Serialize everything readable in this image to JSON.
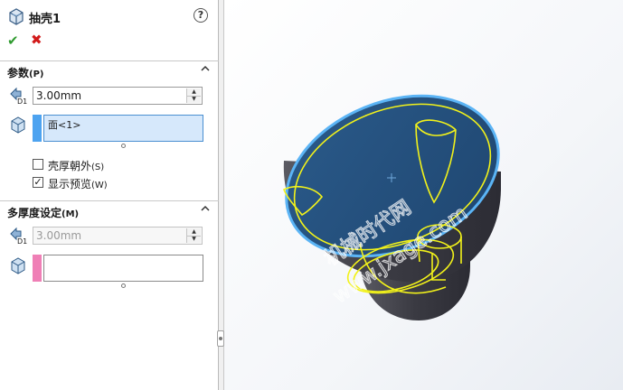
{
  "panel": {
    "title": "抽壳1",
    "help_icon": "help-icon",
    "ok_icon": "check-icon",
    "cancel_icon": "close-icon"
  },
  "parameters": {
    "title": "参数",
    "shortcut": "(P)",
    "thickness": "3.00mm",
    "faces_item": "面<1>",
    "shell_outward_label": "壳厚朝外",
    "shell_outward_shortcut": "(S)",
    "shell_outward_checked": false,
    "show_preview_label": "显示预览",
    "show_preview_shortcut": "(W)",
    "show_preview_checked": true
  },
  "multi_thickness": {
    "title": "多厚度设定",
    "shortcut": "(M)",
    "thickness": "3.00mm"
  },
  "watermark": {
    "line1": "机械时代网",
    "line2": "www.jxage.com"
  },
  "colors": {
    "selection_blue": "#4da3f0",
    "selection_pink": "#ef7fb6",
    "selected_box_fill": "#d6e8fb",
    "model_dark": "#3c3c44",
    "model_face": "#244f7c",
    "preview_yellow": "#f2f21a"
  }
}
